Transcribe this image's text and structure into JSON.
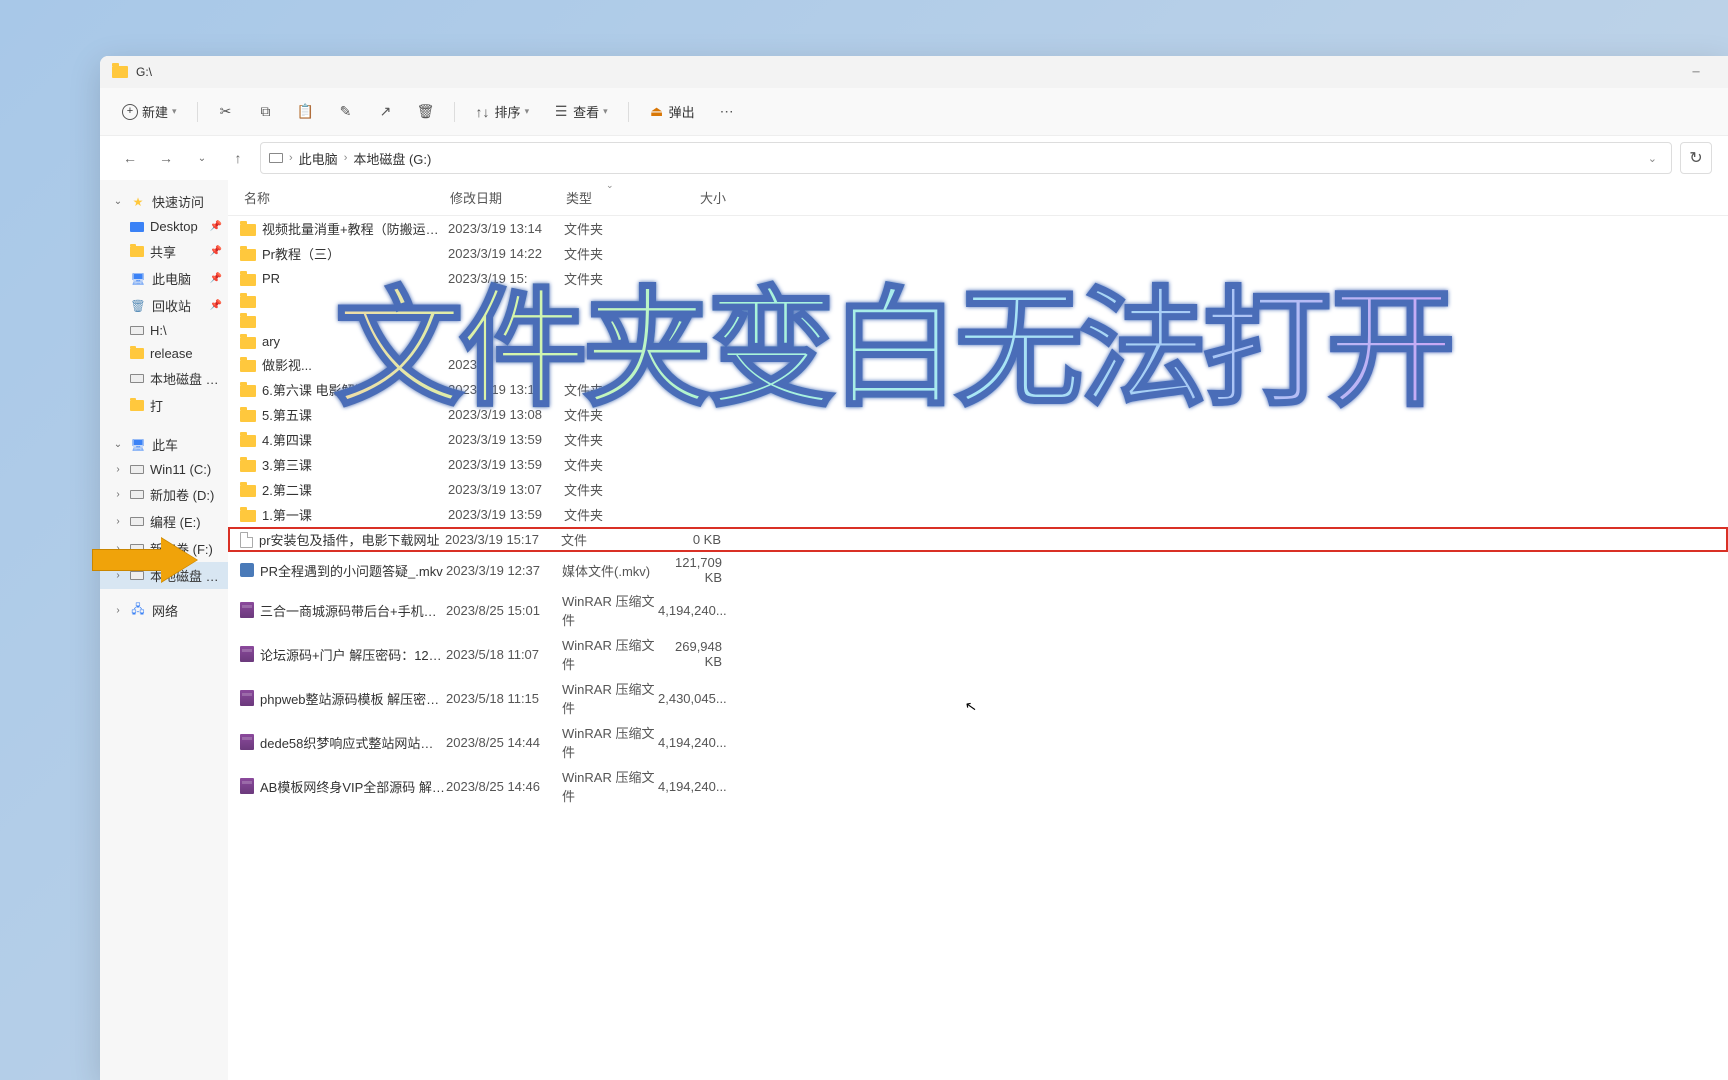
{
  "window": {
    "title": "G:\\"
  },
  "toolbar": {
    "new_label": "新建",
    "sort_label": "排序",
    "view_label": "查看",
    "eject_label": "弹出"
  },
  "breadcrumb": {
    "pc": "此电脑",
    "drive": "本地磁盘 (G:)"
  },
  "sidebar": {
    "quick": "快速访问",
    "items_quick": [
      {
        "label": "Desktop",
        "icon": "desktop",
        "pinned": true
      },
      {
        "label": "共享",
        "icon": "folder",
        "pinned": true
      },
      {
        "label": "此电脑",
        "icon": "pc",
        "pinned": true
      },
      {
        "label": "回收站",
        "icon": "recycle",
        "pinned": true
      },
      {
        "label": "H:\\",
        "icon": "drive",
        "pinned": false
      },
      {
        "label": "release",
        "icon": "folder",
        "pinned": false
      },
      {
        "label": "本地磁盘 (G:)",
        "icon": "drive",
        "pinned": false
      },
      {
        "label": "打",
        "icon": "folder",
        "pinned": false
      }
    ],
    "this_pc": "此车",
    "drives": [
      {
        "label": "Win11 (C:)"
      },
      {
        "label": "新加卷 (D:)"
      },
      {
        "label": "编程 (E:)"
      },
      {
        "label": "新加卷 (F:)"
      },
      {
        "label": "本地磁盘 (G:)",
        "selected": true
      }
    ],
    "network": "网络"
  },
  "columns": {
    "name": "名称",
    "date": "修改日期",
    "type": "类型",
    "size": "大小"
  },
  "files": [
    {
      "icon": "folder",
      "name": "视频批量消重+教程（防搬运工具9月更...",
      "date": "2023/3/19 13:14",
      "type": "文件夹",
      "size": ""
    },
    {
      "icon": "folder",
      "name": "Pr教程（三）",
      "date": "2023/3/19 14:22",
      "type": "文件夹",
      "size": ""
    },
    {
      "icon": "folder",
      "name": "PR",
      "date": "2023/3/19 15:",
      "type": "文件夹",
      "size": ""
    },
    {
      "icon": "folder",
      "name": "",
      "date": "",
      "type": "",
      "size": ""
    },
    {
      "icon": "folder",
      "name": "",
      "date": "",
      "type": "",
      "size": ""
    },
    {
      "icon": "folder",
      "name": "ary",
      "date": "",
      "type": "",
      "size": ""
    },
    {
      "icon": "folder",
      "name": "做影视...",
      "date": "2023/",
      "type": "",
      "size": ""
    },
    {
      "icon": "folder",
      "name": "6.第六课 电影解说",
      "date": "2023/3/19 13:16",
      "type": "文件夹",
      "size": ""
    },
    {
      "icon": "folder",
      "name": "5.第五课",
      "date": "2023/3/19 13:08",
      "type": "文件夹",
      "size": ""
    },
    {
      "icon": "folder",
      "name": "4.第四课",
      "date": "2023/3/19 13:59",
      "type": "文件夹",
      "size": ""
    },
    {
      "icon": "folder",
      "name": "3.第三课",
      "date": "2023/3/19 13:59",
      "type": "文件夹",
      "size": ""
    },
    {
      "icon": "folder",
      "name": "2.第二课",
      "date": "2023/3/19 13:07",
      "type": "文件夹",
      "size": ""
    },
    {
      "icon": "folder",
      "name": "1.第一课",
      "date": "2023/3/19 13:59",
      "type": "文件夹",
      "size": ""
    },
    {
      "icon": "file",
      "name": "pr安装包及插件，电影下载网址",
      "date": "2023/3/19 15:17",
      "type": "文件",
      "size": "0 KB",
      "highlighted": true
    },
    {
      "icon": "mkv",
      "name": "PR全程遇到的小问题答疑_.mkv",
      "date": "2023/3/19 12:37",
      "type": "媒体文件(.mkv)",
      "size": "121,709 KB"
    },
    {
      "icon": "rar",
      "name": "三合一商城源码带后台+手机版 解压密码...",
      "date": "2023/8/25 15:01",
      "type": "WinRAR 压缩文件",
      "size": "4,194,240..."
    },
    {
      "icon": "rar",
      "name": "论坛源码+门户 解压密码：123.rar",
      "date": "2023/5/18 11:07",
      "type": "WinRAR 压缩文件",
      "size": "269,948 KB"
    },
    {
      "icon": "rar",
      "name": "phpweb整站源码模板 解压密码：123.rar",
      "date": "2023/5/18 11:15",
      "type": "WinRAR 压缩文件",
      "size": "2,430,045..."
    },
    {
      "icon": "rar",
      "name": "dede58织梦响应式整站网站源码模板 解...",
      "date": "2023/8/25 14:44",
      "type": "WinRAR 压缩文件",
      "size": "4,194,240..."
    },
    {
      "icon": "rar",
      "name": "AB模板网终身VIP全部源码 解压密码：1...",
      "date": "2023/8/25 14:46",
      "type": "WinRAR 压缩文件",
      "size": "4,194,240..."
    }
  ],
  "overlay": "文件夹变白无法打开"
}
